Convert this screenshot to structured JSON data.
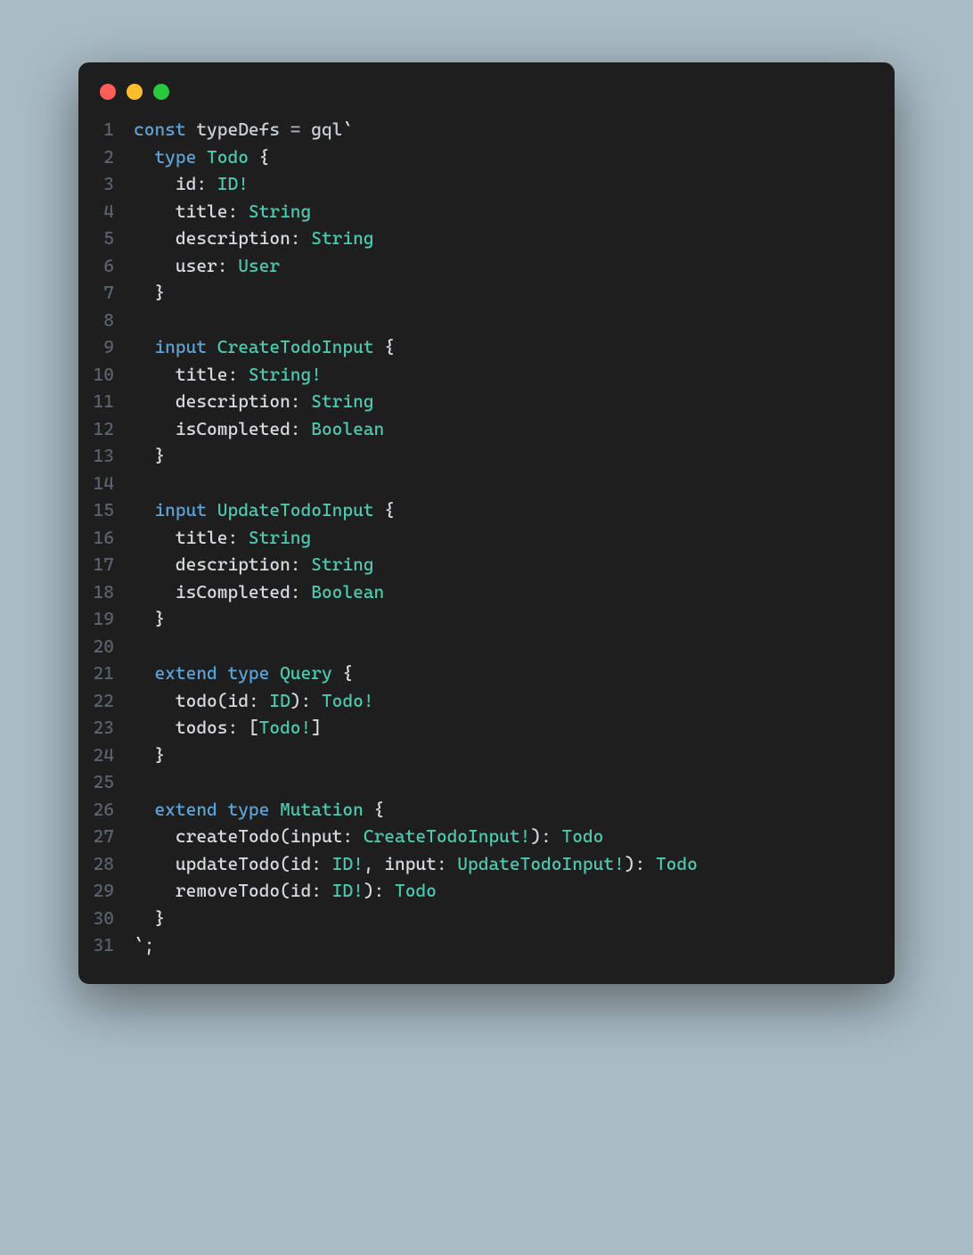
{
  "traffic": {
    "red": "#ff5f56",
    "yellow": "#ffbd2e",
    "green": "#27c93f"
  },
  "lines": [
    {
      "n": "1",
      "t": [
        [
          "kw",
          "const "
        ],
        [
          "fn",
          "typeDefs"
        ],
        [
          "op",
          " = "
        ],
        [
          "fn",
          "gql"
        ],
        [
          "str",
          "`"
        ]
      ]
    },
    {
      "n": "2",
      "t": [
        [
          "str",
          "  "
        ],
        [
          "kw",
          "type"
        ],
        [
          "str",
          " "
        ],
        [
          "type",
          "Todo"
        ],
        [
          "punc",
          " {"
        ]
      ]
    },
    {
      "n": "3",
      "t": [
        [
          "str",
          "    "
        ],
        [
          "field",
          "id"
        ],
        [
          "punc",
          ": "
        ],
        [
          "type",
          "ID"
        ],
        [
          "bang",
          "!"
        ]
      ]
    },
    {
      "n": "4",
      "t": [
        [
          "str",
          "    "
        ],
        [
          "field",
          "title"
        ],
        [
          "punc",
          ": "
        ],
        [
          "type",
          "String"
        ]
      ]
    },
    {
      "n": "5",
      "t": [
        [
          "str",
          "    "
        ],
        [
          "field",
          "description"
        ],
        [
          "punc",
          ": "
        ],
        [
          "type",
          "String"
        ]
      ]
    },
    {
      "n": "6",
      "t": [
        [
          "str",
          "    "
        ],
        [
          "field",
          "user"
        ],
        [
          "punc",
          ": "
        ],
        [
          "type",
          "User"
        ]
      ]
    },
    {
      "n": "7",
      "t": [
        [
          "punc",
          "  }"
        ]
      ]
    },
    {
      "n": "8",
      "t": [
        [
          "str",
          ""
        ]
      ]
    },
    {
      "n": "9",
      "t": [
        [
          "str",
          "  "
        ],
        [
          "kw",
          "input"
        ],
        [
          "str",
          " "
        ],
        [
          "type",
          "CreateTodoInput"
        ],
        [
          "punc",
          " {"
        ]
      ]
    },
    {
      "n": "10",
      "t": [
        [
          "str",
          "    "
        ],
        [
          "field",
          "title"
        ],
        [
          "punc",
          ": "
        ],
        [
          "type",
          "String"
        ],
        [
          "bang",
          "!"
        ]
      ]
    },
    {
      "n": "11",
      "t": [
        [
          "str",
          "    "
        ],
        [
          "field",
          "description"
        ],
        [
          "punc",
          ": "
        ],
        [
          "type",
          "String"
        ]
      ]
    },
    {
      "n": "12",
      "t": [
        [
          "str",
          "    "
        ],
        [
          "field",
          "isCompleted"
        ],
        [
          "punc",
          ": "
        ],
        [
          "type",
          "Boolean"
        ]
      ]
    },
    {
      "n": "13",
      "t": [
        [
          "punc",
          "  }"
        ]
      ]
    },
    {
      "n": "14",
      "t": [
        [
          "str",
          ""
        ]
      ]
    },
    {
      "n": "15",
      "t": [
        [
          "str",
          "  "
        ],
        [
          "kw",
          "input"
        ],
        [
          "str",
          " "
        ],
        [
          "type",
          "UpdateTodoInput"
        ],
        [
          "punc",
          " {"
        ]
      ]
    },
    {
      "n": "16",
      "t": [
        [
          "str",
          "    "
        ],
        [
          "field",
          "title"
        ],
        [
          "punc",
          ": "
        ],
        [
          "type",
          "String"
        ]
      ]
    },
    {
      "n": "17",
      "t": [
        [
          "str",
          "    "
        ],
        [
          "field",
          "description"
        ],
        [
          "punc",
          ": "
        ],
        [
          "type",
          "String"
        ]
      ]
    },
    {
      "n": "18",
      "t": [
        [
          "str",
          "    "
        ],
        [
          "field",
          "isCompleted"
        ],
        [
          "punc",
          ": "
        ],
        [
          "type",
          "Boolean"
        ]
      ]
    },
    {
      "n": "19",
      "t": [
        [
          "punc",
          "  }"
        ]
      ]
    },
    {
      "n": "20",
      "t": [
        [
          "str",
          ""
        ]
      ]
    },
    {
      "n": "21",
      "t": [
        [
          "str",
          "  "
        ],
        [
          "kw",
          "extend"
        ],
        [
          "str",
          " "
        ],
        [
          "kw",
          "type"
        ],
        [
          "str",
          " "
        ],
        [
          "type",
          "Query"
        ],
        [
          "punc",
          " {"
        ]
      ]
    },
    {
      "n": "22",
      "t": [
        [
          "str",
          "    "
        ],
        [
          "field",
          "todo"
        ],
        [
          "punc",
          "("
        ],
        [
          "field",
          "id"
        ],
        [
          "punc",
          ": "
        ],
        [
          "type",
          "ID"
        ],
        [
          "punc",
          ")"
        ],
        [
          "punc",
          ": "
        ],
        [
          "type",
          "Todo"
        ],
        [
          "bang",
          "!"
        ]
      ]
    },
    {
      "n": "23",
      "t": [
        [
          "str",
          "    "
        ],
        [
          "field",
          "todos"
        ],
        [
          "punc",
          ": "
        ],
        [
          "bracket",
          "["
        ],
        [
          "type",
          "Todo"
        ],
        [
          "bang",
          "!"
        ],
        [
          "bracket",
          "]"
        ]
      ]
    },
    {
      "n": "24",
      "t": [
        [
          "punc",
          "  }"
        ]
      ]
    },
    {
      "n": "25",
      "t": [
        [
          "str",
          ""
        ]
      ]
    },
    {
      "n": "26",
      "t": [
        [
          "str",
          "  "
        ],
        [
          "kw",
          "extend"
        ],
        [
          "str",
          " "
        ],
        [
          "kw",
          "type"
        ],
        [
          "str",
          " "
        ],
        [
          "type",
          "Mutation"
        ],
        [
          "punc",
          " {"
        ]
      ]
    },
    {
      "n": "27",
      "t": [
        [
          "str",
          "    "
        ],
        [
          "field",
          "createTodo"
        ],
        [
          "punc",
          "("
        ],
        [
          "field",
          "input"
        ],
        [
          "punc",
          ": "
        ],
        [
          "type",
          "CreateTodoInput"
        ],
        [
          "bang",
          "!"
        ],
        [
          "punc",
          ")"
        ],
        [
          "punc",
          ": "
        ],
        [
          "type",
          "Todo"
        ]
      ]
    },
    {
      "n": "28",
      "t": [
        [
          "str",
          "    "
        ],
        [
          "field",
          "updateTodo"
        ],
        [
          "punc",
          "("
        ],
        [
          "field",
          "id"
        ],
        [
          "punc",
          ": "
        ],
        [
          "type",
          "ID"
        ],
        [
          "bang",
          "!"
        ],
        [
          "punc",
          ", "
        ],
        [
          "field",
          "input"
        ],
        [
          "punc",
          ": "
        ],
        [
          "type",
          "UpdateTodoInput"
        ],
        [
          "bang",
          "!"
        ],
        [
          "punc",
          ")"
        ],
        [
          "punc",
          ": "
        ],
        [
          "type",
          "Todo"
        ]
      ]
    },
    {
      "n": "29",
      "t": [
        [
          "str",
          "    "
        ],
        [
          "field",
          "removeTodo"
        ],
        [
          "punc",
          "("
        ],
        [
          "field",
          "id"
        ],
        [
          "punc",
          ": "
        ],
        [
          "type",
          "ID"
        ],
        [
          "bang",
          "!"
        ],
        [
          "punc",
          ")"
        ],
        [
          "punc",
          ": "
        ],
        [
          "type",
          "Todo"
        ]
      ]
    },
    {
      "n": "30",
      "t": [
        [
          "punc",
          "  }"
        ]
      ]
    },
    {
      "n": "31",
      "t": [
        [
          "str",
          "`"
        ],
        [
          "punc",
          ";"
        ]
      ]
    }
  ]
}
